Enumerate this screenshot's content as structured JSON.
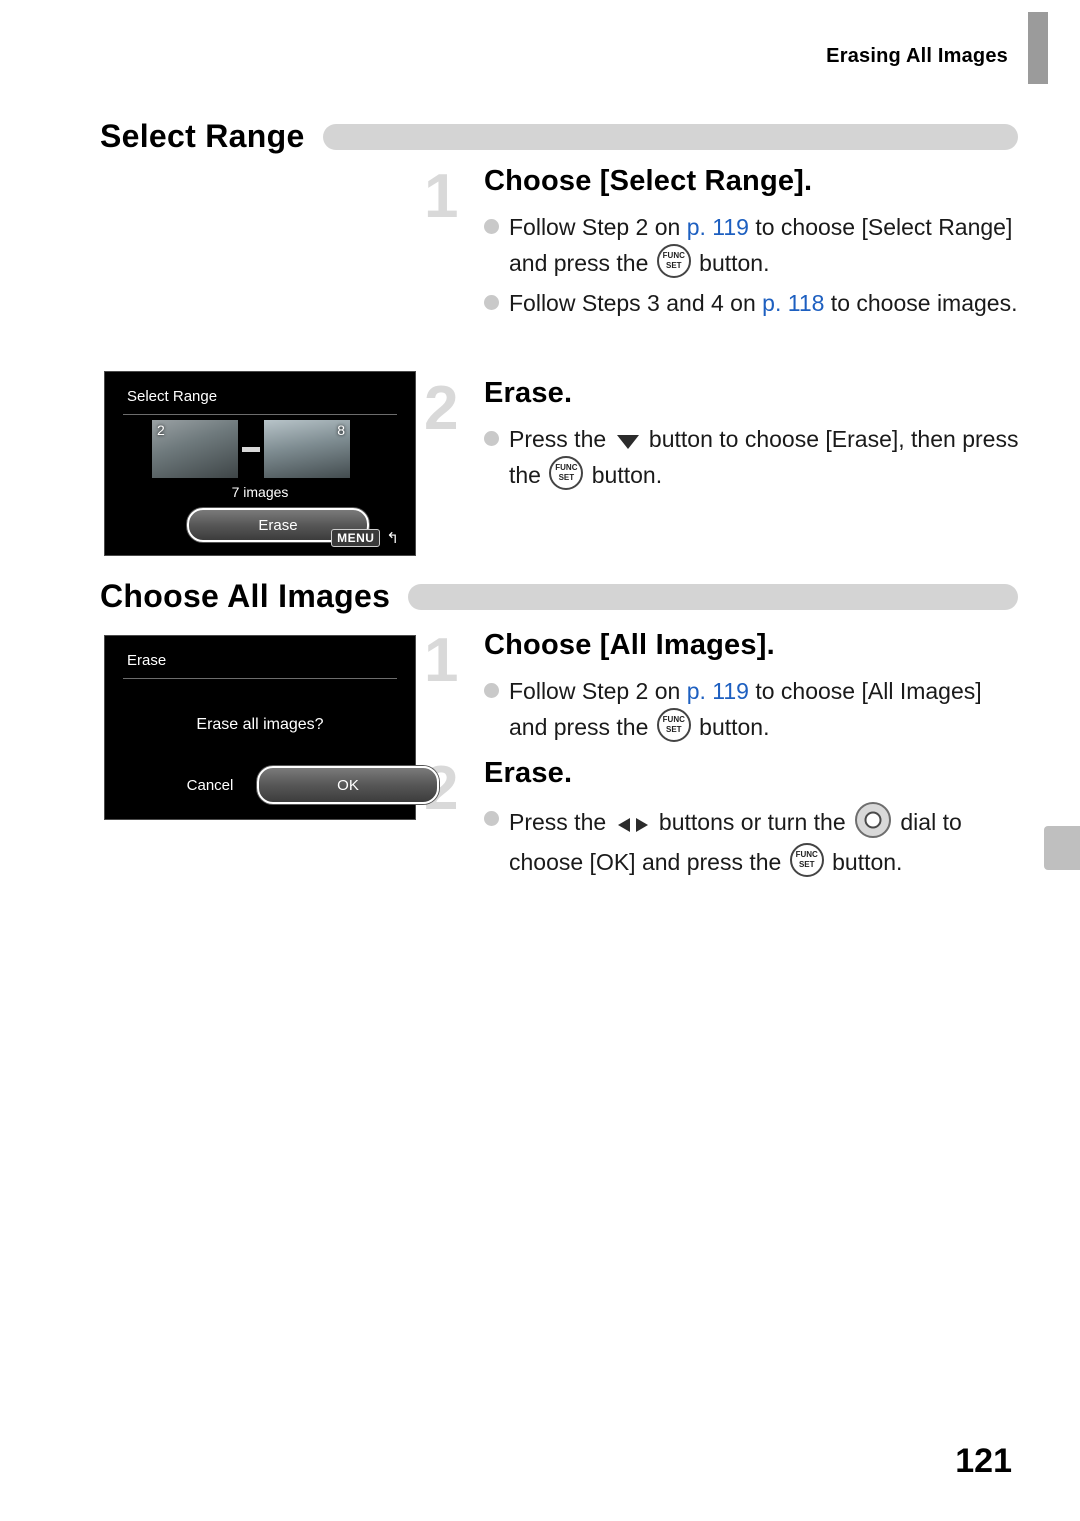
{
  "header": {
    "running_head": "Erasing All Images"
  },
  "page_number": "121",
  "sections": [
    {
      "title": "Select Range",
      "steps": [
        {
          "num": "1",
          "head": "Choose [Select Range].",
          "bullets": [
            {
              "parts": [
                {
                  "t": "text",
                  "v": "Follow Step 2 on "
                },
                {
                  "t": "pg",
                  "v": "p. 119"
                },
                {
                  "t": "text",
                  "v": " to choose [Select Range] and press the "
                },
                {
                  "t": "icon",
                  "v": "func-set-icon"
                },
                {
                  "t": "text",
                  "v": " button."
                }
              ]
            },
            {
              "parts": [
                {
                  "t": "text",
                  "v": "Follow Steps 3 and 4 on "
                },
                {
                  "t": "pg",
                  "v": "p. 118"
                },
                {
                  "t": "text",
                  "v": " to choose images."
                }
              ]
            }
          ]
        },
        {
          "num": "2",
          "head": "Erase.",
          "bullets": [
            {
              "parts": [
                {
                  "t": "text",
                  "v": "Press the "
                },
                {
                  "t": "icon",
                  "v": "down-arrow-icon"
                },
                {
                  "t": "text",
                  "v": " button to choose [Erase], then press the "
                },
                {
                  "t": "icon",
                  "v": "func-set-icon"
                },
                {
                  "t": "text",
                  "v": " button."
                }
              ]
            }
          ]
        }
      ]
    },
    {
      "title": "Choose All Images",
      "steps": [
        {
          "num": "1",
          "head": "Choose [All Images].",
          "bullets": [
            {
              "parts": [
                {
                  "t": "text",
                  "v": "Follow Step 2 on "
                },
                {
                  "t": "pg",
                  "v": "p. 119"
                },
                {
                  "t": "text",
                  "v": " to choose [All Images] and press the "
                },
                {
                  "t": "icon",
                  "v": "func-set-icon"
                },
                {
                  "t": "text",
                  "v": " button."
                }
              ]
            }
          ]
        },
        {
          "num": "2",
          "head": "Erase.",
          "bullets": [
            {
              "parts": [
                {
                  "t": "text",
                  "v": "Press the "
                },
                {
                  "t": "icon",
                  "v": "left-right-arrows-icon"
                },
                {
                  "t": "text",
                  "v": " buttons or turn the "
                },
                {
                  "t": "icon",
                  "v": "control-dial-icon"
                },
                {
                  "t": "text",
                  "v": " dial to choose [OK] and press the "
                },
                {
                  "t": "icon",
                  "v": "func-set-icon"
                },
                {
                  "t": "text",
                  "v": " button."
                }
              ]
            }
          ]
        }
      ]
    }
  ],
  "lcd_select_range": {
    "title": "Select Range",
    "thumb_left_number": "2",
    "thumb_right_number": "8",
    "image_count": "7 images",
    "button_label": "Erase",
    "menu_badge": "MENU",
    "back_glyph": "↰"
  },
  "lcd_erase_all": {
    "title": "Erase",
    "question": "Erase all images?",
    "cancel_label": "Cancel",
    "ok_label": "OK"
  },
  "colors": {
    "link": "#1d5fc0",
    "title_bar": "#d4d4d4",
    "step_number": "#d9d9d9"
  }
}
